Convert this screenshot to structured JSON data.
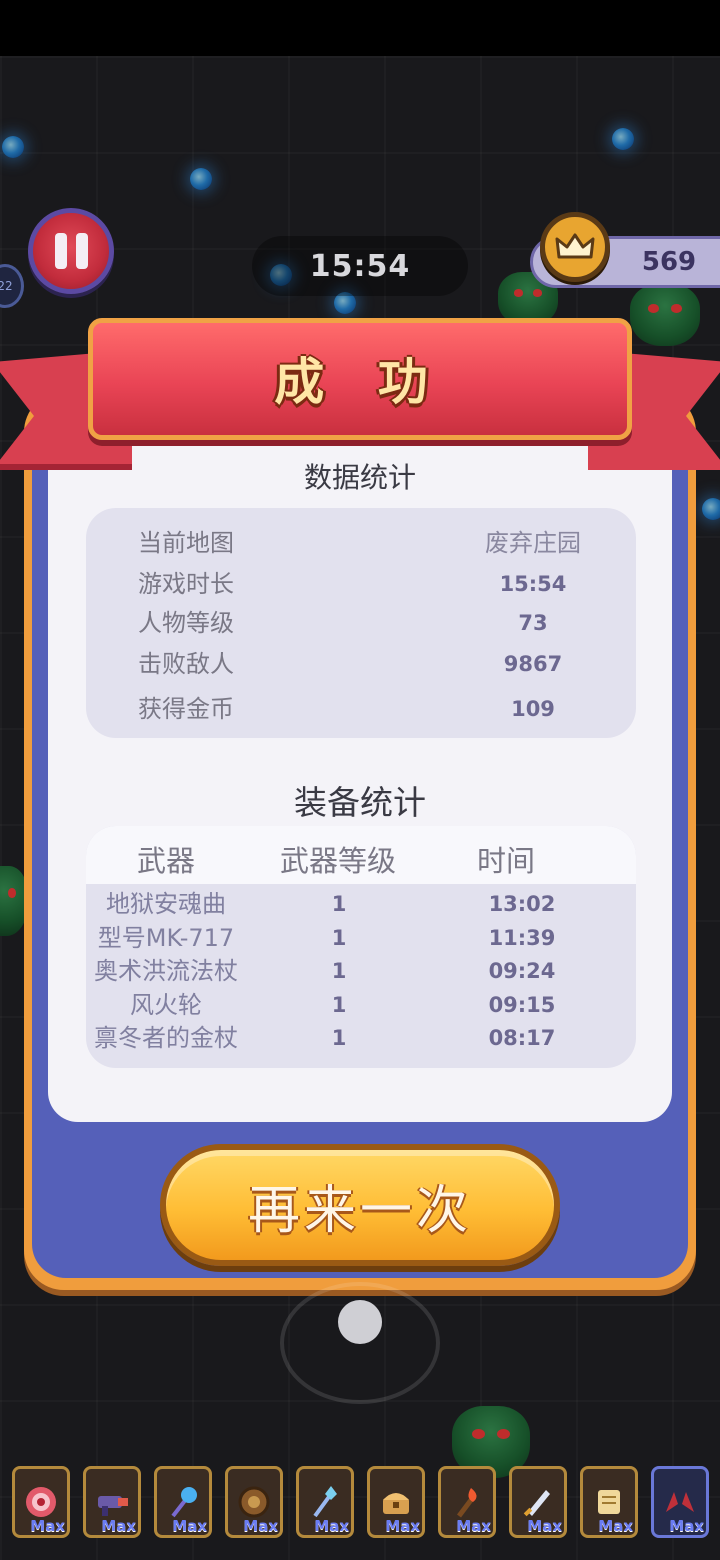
{
  "hud": {
    "timer": "15:54",
    "coins": "569",
    "level_chip": "22"
  },
  "result": {
    "title": "成 功",
    "stats_title": "数据统计",
    "stats": [
      {
        "label": "当前地图",
        "value": "废弃庄园"
      },
      {
        "label": "游戏时长",
        "value": "15:54"
      },
      {
        "label": "人物等级",
        "value": "73"
      },
      {
        "label": "击败敌人",
        "value": "9867"
      },
      {
        "label": "获得金币",
        "value": "109"
      }
    ],
    "equip_title": "装备统计",
    "equip_headers": [
      "武器",
      "武器等级",
      "时间"
    ],
    "equipment": [
      {
        "name": "地狱安魂曲",
        "level": "1",
        "time": "13:02"
      },
      {
        "name": "型号MK-717",
        "level": "1",
        "time": "11:39"
      },
      {
        "name": "奥术洪流法杖",
        "level": "1",
        "time": "09:24"
      },
      {
        "name": "风火轮",
        "level": "1",
        "time": "09:15"
      },
      {
        "name": "禀冬者的金杖",
        "level": "1",
        "time": "08:17"
      }
    ],
    "retry_label": "再来一次"
  },
  "skill_bar": {
    "slots": [
      {
        "icon": "target-ring-icon",
        "tag": "Max"
      },
      {
        "icon": "blaster-icon",
        "tag": "Max"
      },
      {
        "icon": "orb-staff-icon",
        "tag": "Max"
      },
      {
        "icon": "spiked-shield-icon",
        "tag": "Max"
      },
      {
        "icon": "crystal-staff-icon",
        "tag": "Max"
      },
      {
        "icon": "treasure-chest-icon",
        "tag": "Max"
      },
      {
        "icon": "torch-icon",
        "tag": "Max"
      },
      {
        "icon": "sword-icon",
        "tag": "Max"
      },
      {
        "icon": "scroll-icon",
        "tag": "Max"
      },
      {
        "icon": "twin-claws-icon",
        "tag": "Max"
      }
    ]
  },
  "colors": {
    "ribbon": "#e94455",
    "frame": "#5560b9",
    "frame_border": "#f09d3d",
    "button": "#ffbd35",
    "value_text": "#6c6890"
  }
}
